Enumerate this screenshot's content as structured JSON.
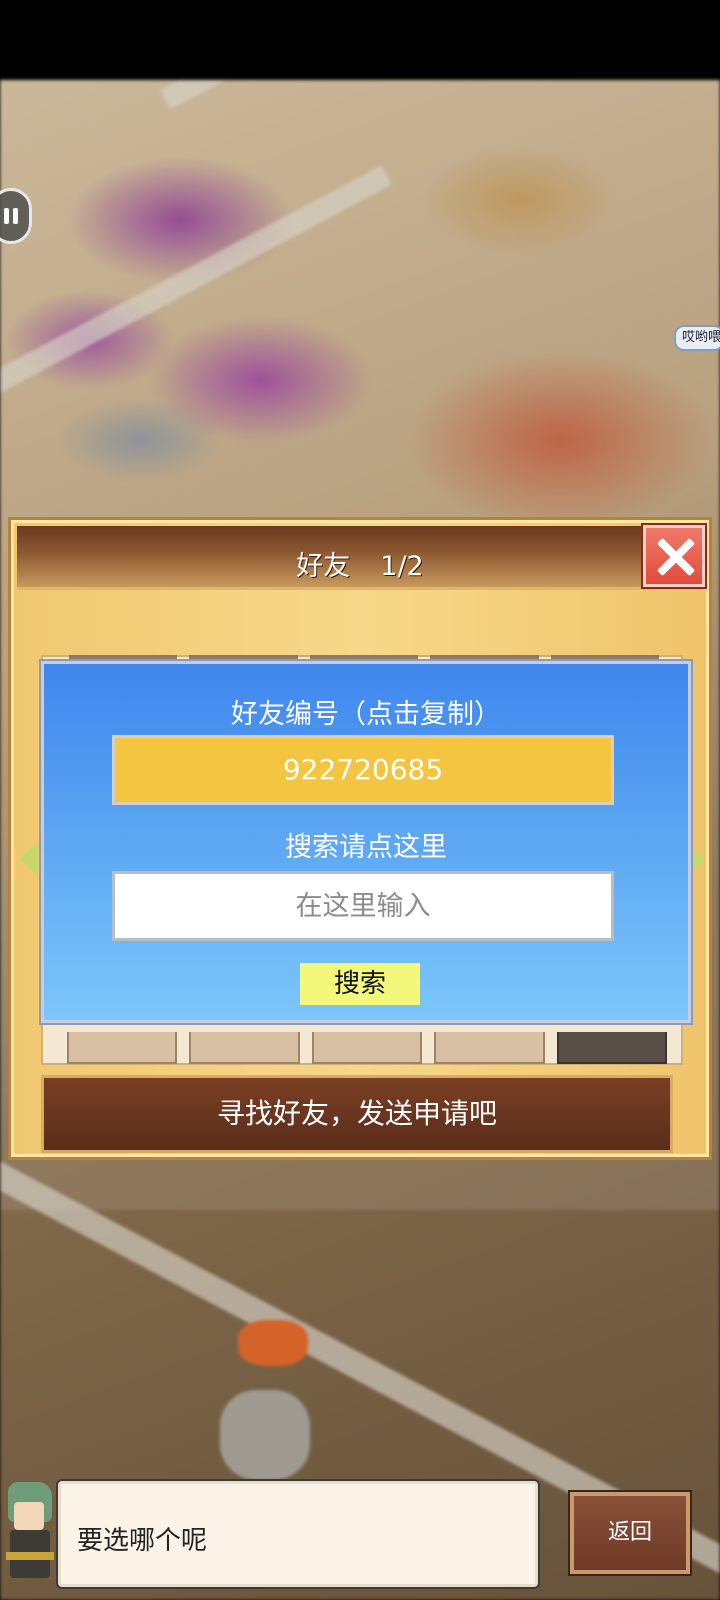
{
  "overlay": {
    "speech_tag": "哎哟喂"
  },
  "dialog": {
    "title": "好友",
    "page": "1/2",
    "friend_code_label": "好友编号（点击复制）",
    "friend_code": "922720685",
    "search_label": "搜索请点这里",
    "search_placeholder": "在这里输入",
    "search_button": "搜索",
    "find_friend_text": "寻找好友，发送申请吧"
  },
  "bottom_bar": {
    "message": "要选哪个呢",
    "back_label": "返回"
  },
  "colors": {
    "panel_blue": "#3f86ee",
    "friend_code_bg": "#f4c540",
    "search_button_bg": "#f3f77a",
    "close_button_red": "#e24b3c",
    "header_brown": "#6b3a1f"
  },
  "icons": [
    "pause-icon",
    "close-icon",
    "arrow-left-icon",
    "arrow-right-icon"
  ]
}
